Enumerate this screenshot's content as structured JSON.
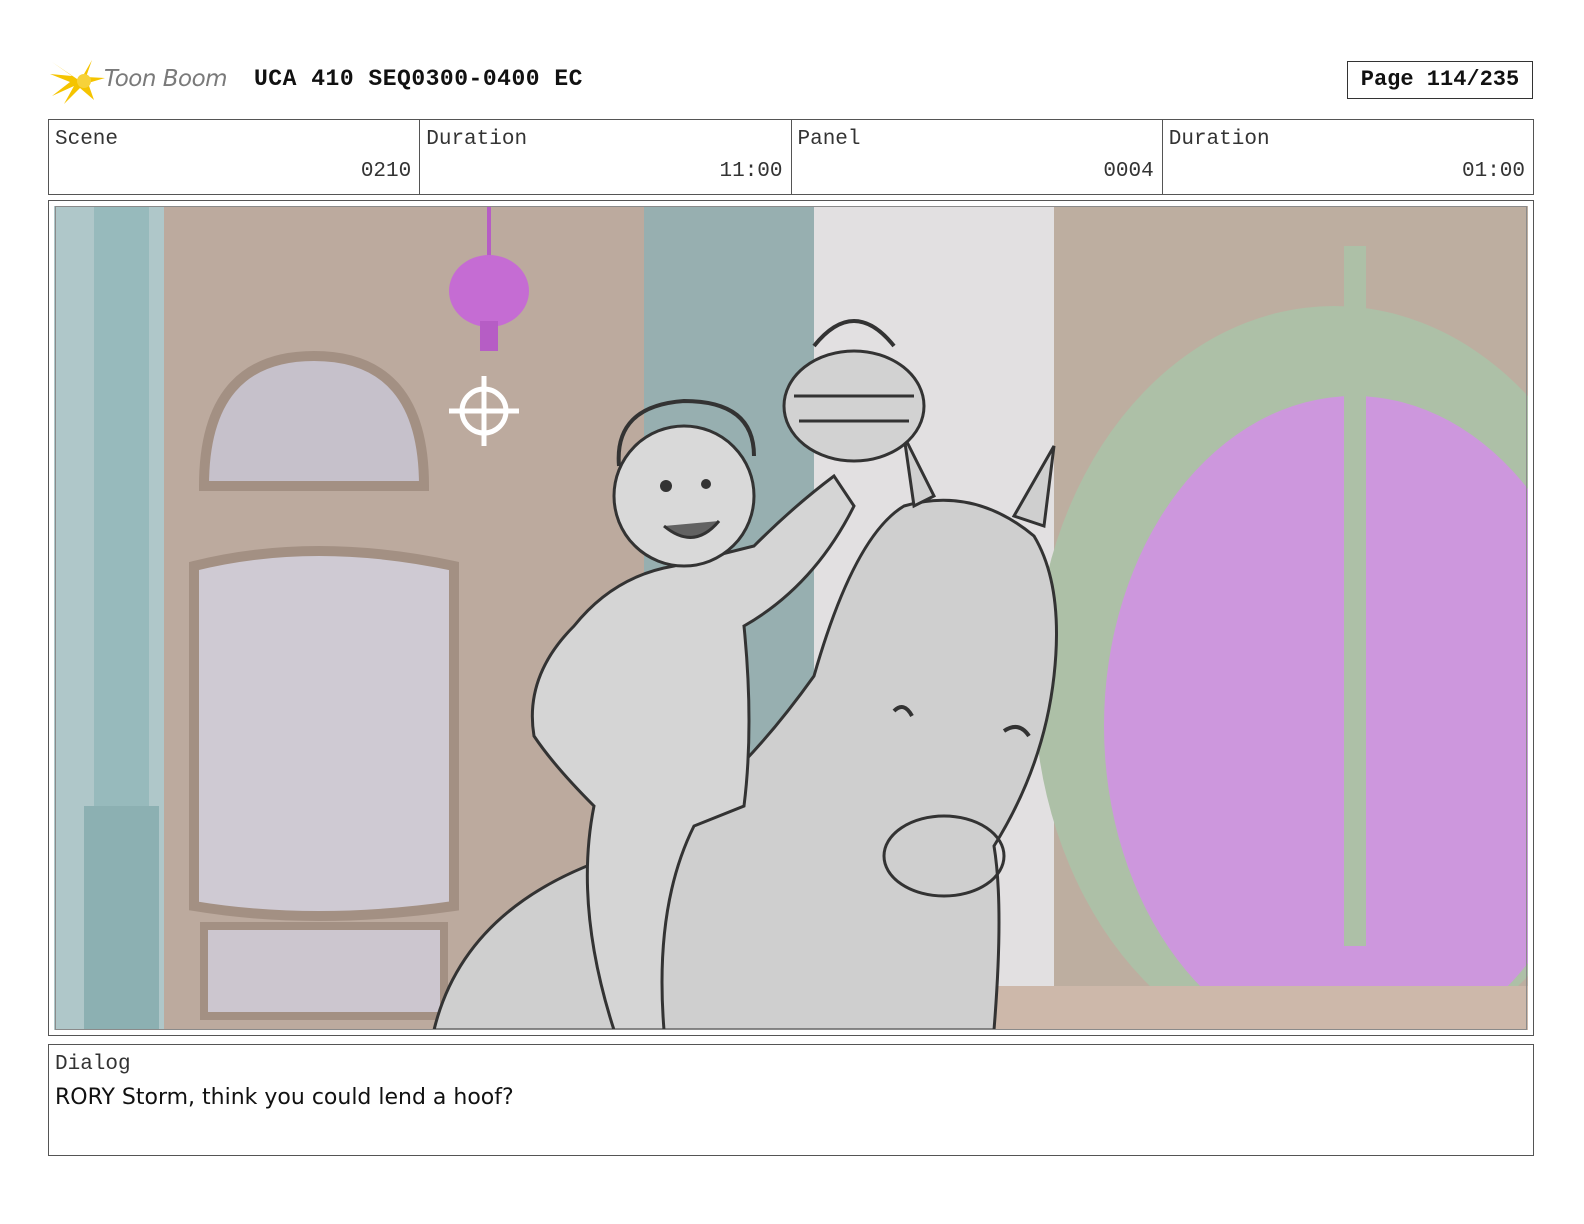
{
  "header": {
    "logo_text": "Toon Boom",
    "title": "UCA 410 SEQ0300-0400 EC",
    "page": "Page 114/235"
  },
  "info": {
    "scene_label": "Scene",
    "scene_value": "0210",
    "scene_duration_label": "Duration",
    "scene_duration_value": "11:00",
    "panel_label": "Panel",
    "panel_value": "0004",
    "panel_duration_label": "Duration",
    "panel_duration_value": "01:00"
  },
  "dialog": {
    "label": "Dialog",
    "text": "RORY Storm, think you could lend a hoof?"
  },
  "colors": {
    "logo_yellow": "#f5c400",
    "window_magenta": "#c98fdb",
    "arch_green": "#a7bba0",
    "wall_brown": "#b7a396",
    "column_teal": "#8fb5b7",
    "sketch_fill": "#cbcbcb"
  }
}
